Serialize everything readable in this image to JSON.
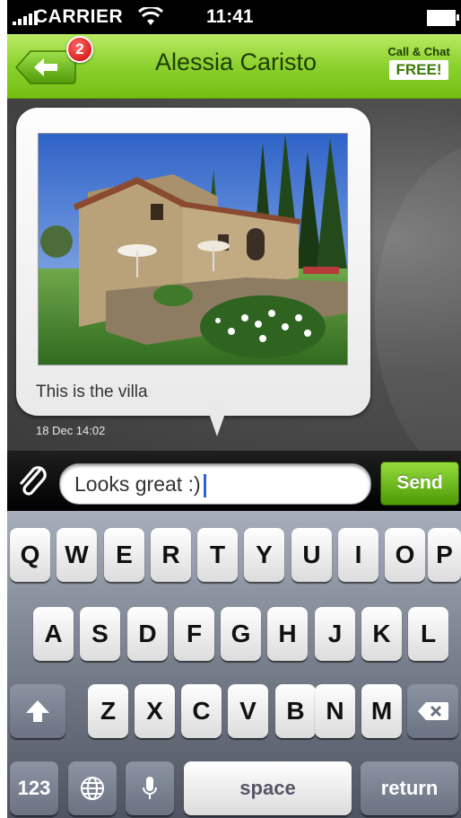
{
  "status_bar": {
    "carrier": "CARRIER",
    "time": "11:41"
  },
  "header": {
    "title": "Alessia Caristo",
    "badge_count": "2",
    "call_chat_label": "Call & Chat",
    "free_label": "FREE!"
  },
  "message": {
    "text": "This is the villa",
    "timestamp": "18 Dec 14:02"
  },
  "composer": {
    "value": "Looks great :)",
    "send_label": "Send"
  },
  "keyboard": {
    "row1": [
      "Q",
      "W",
      "E",
      "R",
      "T",
      "Y",
      "U",
      "I",
      "O",
      "P"
    ],
    "row2": [
      "A",
      "S",
      "D",
      "F",
      "G",
      "H",
      "J",
      "K",
      "L"
    ],
    "row3": [
      "Z",
      "X",
      "C",
      "V",
      "B",
      "N",
      "M"
    ],
    "numbers_label": "123",
    "space_label": "space",
    "return_label": "return"
  },
  "colors": {
    "header_green": "#8cd12e",
    "send_green": "#5aa60c",
    "badge_red": "#d00000"
  }
}
